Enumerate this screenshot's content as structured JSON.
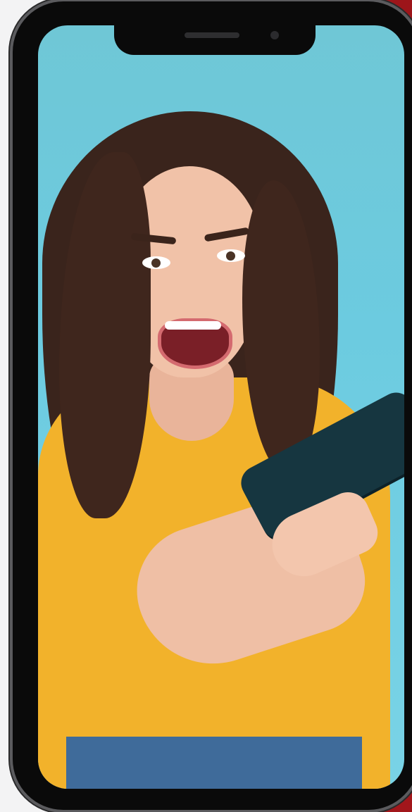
{
  "image": {
    "subject": "woman-playing-mobile-game",
    "frame": "smartphone-mockup"
  },
  "colors": {
    "screen_bg": "#6ccbe0",
    "shirt": "#f2b22b",
    "hair": "#3a241c",
    "phone_body": "#0a0a0a",
    "held_phone": "#163640",
    "accent_red": "#a2161b",
    "page_bg": "#f3f3f4"
  }
}
